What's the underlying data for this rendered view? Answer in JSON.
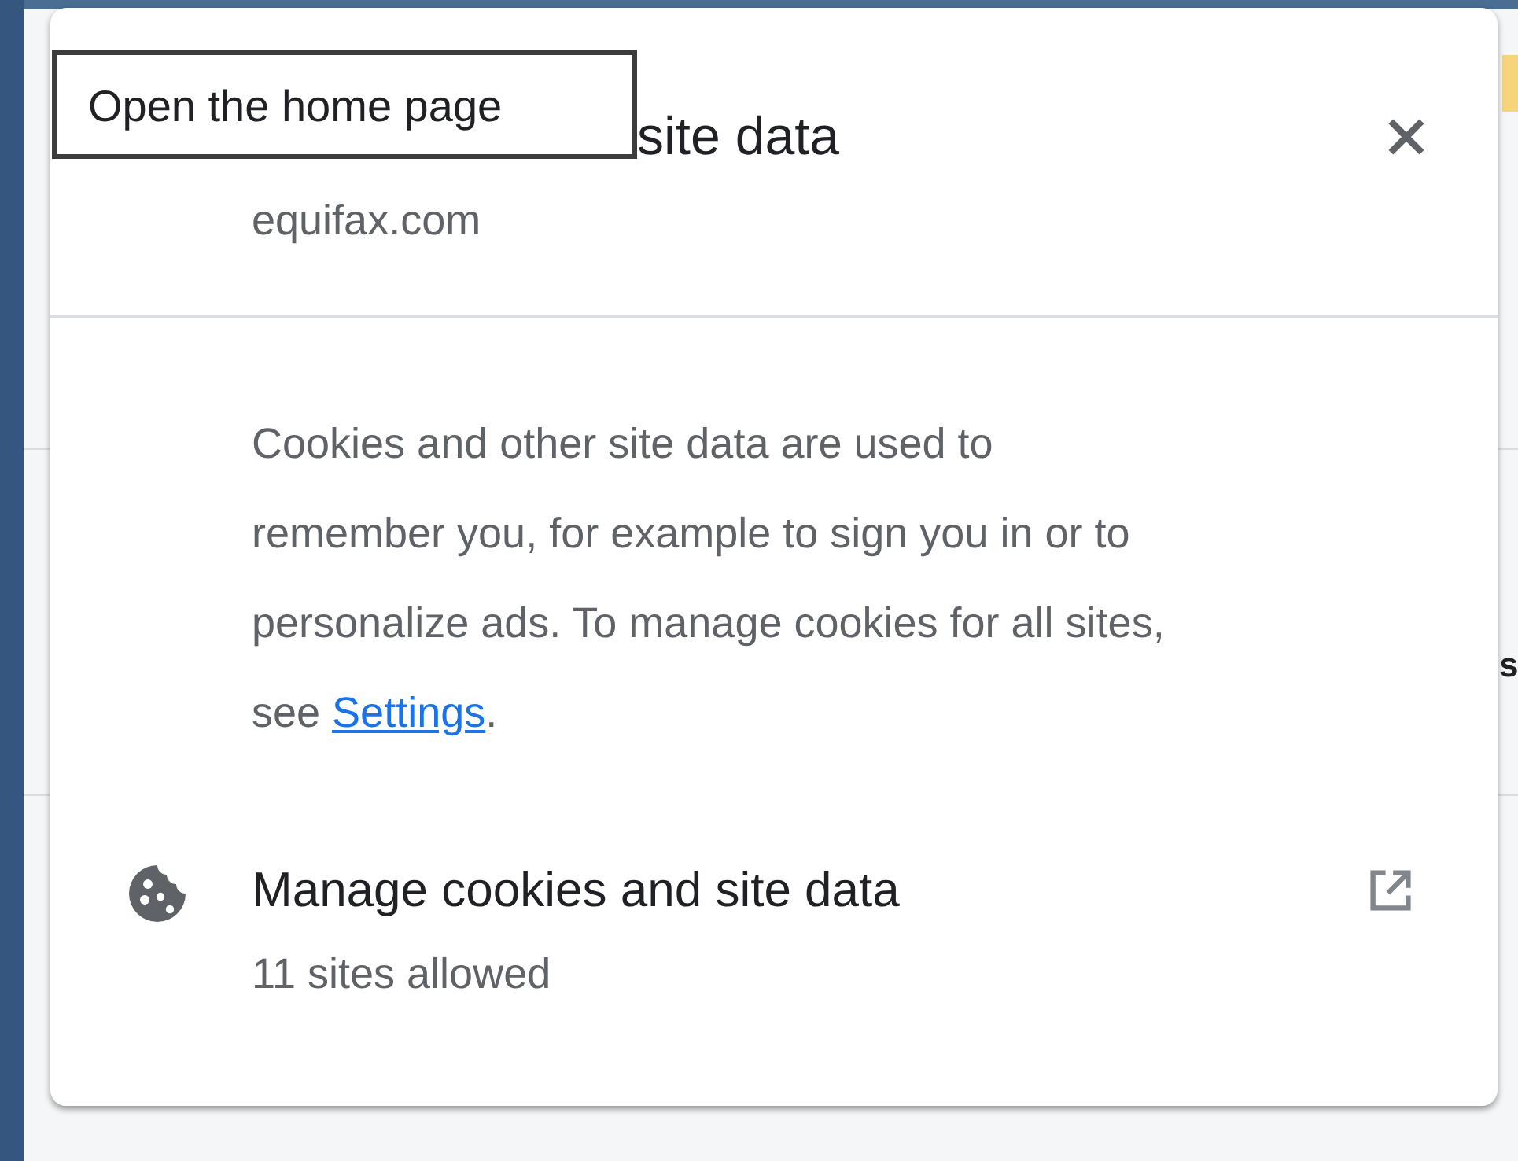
{
  "background": {
    "fragment": "s"
  },
  "tooltip": {
    "text": "Open the home page"
  },
  "dialog": {
    "title": "site data",
    "domain": "equifax.com",
    "description": {
      "text": "Cookies and other site data are used to remember you, for example to sign you in or to personalize ads. To manage cookies for all sites, see ",
      "link": "Settings",
      "end": "."
    },
    "manage": {
      "label": "Manage cookies and site data",
      "detail": "11 sites allowed"
    }
  }
}
